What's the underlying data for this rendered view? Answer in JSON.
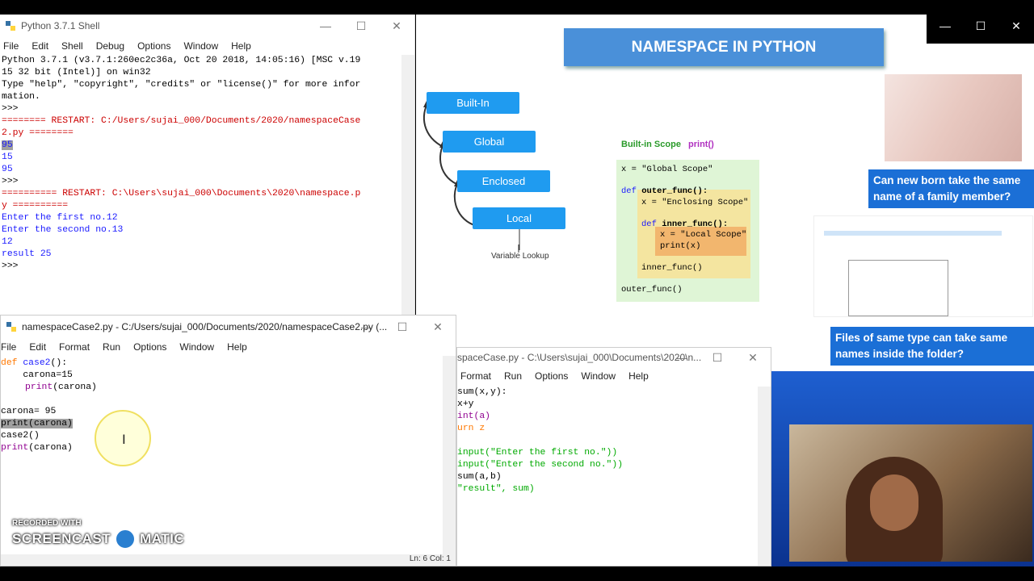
{
  "shell": {
    "title": "Python 3.7.1 Shell",
    "menu": [
      "File",
      "Edit",
      "Shell",
      "Debug",
      "Options",
      "Window",
      "Help"
    ],
    "lines": [
      "Python 3.7.1 (v3.7.1:260ec2c36a, Oct 20 2018, 14:05:16) [MSC v.19",
      "15 32 bit (Intel)] on win32",
      "Type \"help\", \"copyright\", \"credits\" or \"license()\" for more infor",
      "mation.",
      ">>> ",
      "======== RESTART: C:/Users/sujai_000/Documents/2020/namespaceCase",
      "2.py ========",
      "95",
      "15",
      "95",
      ">>> ",
      "========== RESTART: C:\\Users\\sujai_000\\Documents\\2020\\namespace.p",
      "y ==========",
      "Enter the first no.12",
      "Enter the second no.13",
      "12",
      "result 25",
      ">>> "
    ]
  },
  "slide": {
    "title": "NAMESPACE IN PYTHON",
    "scopes": [
      "Built-In",
      "Global",
      "Enclosed",
      "Local"
    ],
    "variable_lookup": "Variable Lookup",
    "builtin_scope": "Built-in Scope",
    "builtin_print": "print()",
    "code": {
      "l1": "x = \"Global Scope\"",
      "l2_kw": "def ",
      "l2_fn": "outer_func():",
      "l3": "x = \"Enclosing Scope\"",
      "l4_kw": "def ",
      "l4_fn": "inner_func():",
      "l5": "x = \"Local Scope\"",
      "l6": "print(x)",
      "l7": "inner_func()",
      "l8": "outer_func()"
    },
    "card1": "Can new born take the same name of a family member?",
    "card2": "Files of same type can take same names inside the folder?"
  },
  "editor": {
    "title": "namespaceCase2.py - C:/Users/sujai_000/Documents/2020/namespaceCase2.py (...",
    "menu": [
      "File",
      "Edit",
      "Format",
      "Run",
      "Options",
      "Window",
      "Help"
    ],
    "status": "Ln: 6   Col: 1",
    "code": {
      "l1_kw": "def ",
      "l1_fn": "case2",
      "l1_rest": "():",
      "l2": "    carona=15",
      "l3_fn": "print",
      "l3_rest": "(carona)",
      "l5": "carona= 95",
      "l6": "print(carona)",
      "l7": "case2()",
      "l8_fn": "print",
      "l8_rest": "(carona)"
    }
  },
  "editor2": {
    "title": "spaceCase.py - C:\\Users\\sujai_000\\Documents\\2020\\n...",
    "title_visible": "spaceCase.py - C:\\Users\\sujai_000\\Documents\\2020\\n...",
    "menu": [
      "Format",
      "Run",
      "Options",
      "Window",
      "Help"
    ],
    "lines": [
      "sum(x,y):",
      "x+y",
      "int(a)",
      "urn z",
      "",
      "input(\"Enter the first no.\"))",
      "input(\"Enter the second no.\"))",
      "sum(a,b)",
      "\"result\", sum)"
    ]
  },
  "watermark": {
    "line1": "RECORDED WITH",
    "line2a": "SCREENCAST",
    "line2b": "MATIC"
  }
}
